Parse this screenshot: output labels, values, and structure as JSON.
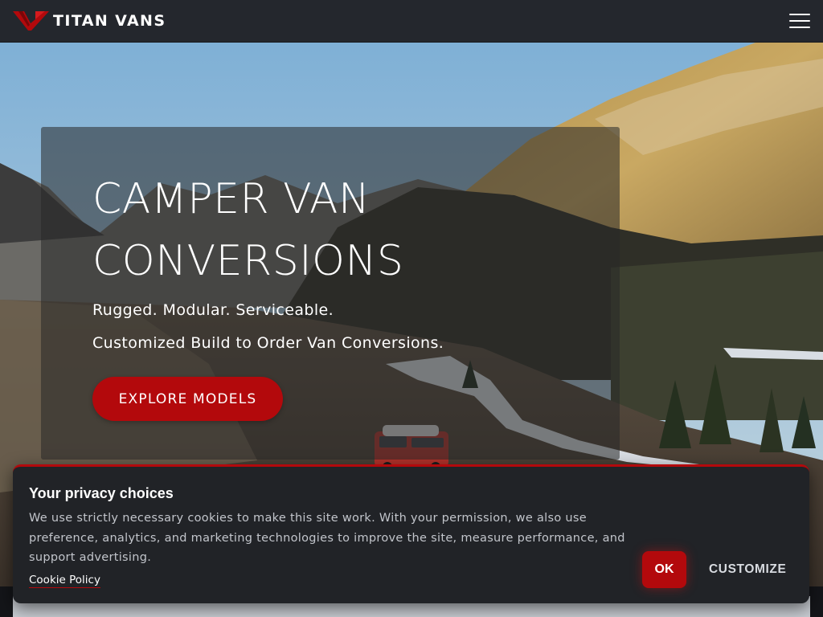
{
  "header": {
    "brand_name": "TITAN VANS",
    "logo_icon": "titan-chevron-logo",
    "menu_icon": "hamburger-menu-icon",
    "brand_color": "#b3090c",
    "background_color": "#24272d"
  },
  "hero": {
    "title": "CAMPER VAN CONVERSIONS",
    "tagline": "Rugged. Modular. Serviceable.",
    "subtitle": "Customized Build to Order Van Conversions.",
    "cta_label": "EXPLORE MODELS",
    "cta_color": "#b3090c"
  },
  "cookie_banner": {
    "title": "Your privacy choices",
    "text": "We use strictly necessary cookies to make this site work. With your permission, we also use preference, analytics, and marketing technologies to improve the site, measure performance, and support advertising.",
    "policy_link": "Cookie Policy",
    "ok_label": "OK",
    "customize_label": "CUSTOMIZE",
    "accent_color": "#b3090c",
    "background_color": "#212327"
  }
}
